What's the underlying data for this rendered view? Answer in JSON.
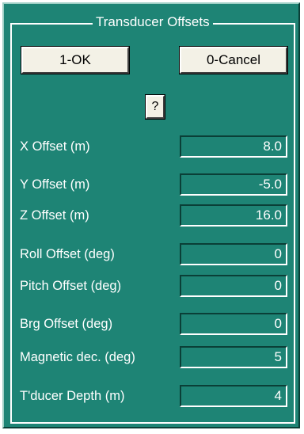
{
  "window": {
    "group_title": "Transducer Offsets"
  },
  "buttons": {
    "ok_label": "1-OK",
    "cancel_label": "0-Cancel",
    "help_label": "?"
  },
  "fields": [
    {
      "label": "X Offset (m)",
      "value": "8.0"
    },
    {
      "label": "Y Offset (m)",
      "value": "-5.0"
    },
    {
      "label": "Z Offset (m)",
      "value": "16.0"
    },
    {
      "label": "Roll Offset (deg)",
      "value": "0"
    },
    {
      "label": "Pitch Offset (deg)",
      "value": "0"
    },
    {
      "label": "Brg Offset (deg)",
      "value": "0"
    },
    {
      "label": "Magnetic dec. (deg)",
      "value": "5"
    },
    {
      "label": "T'ducer Depth (m)",
      "value": "4"
    }
  ],
  "colors": {
    "panel_background": "#1e8475",
    "button_face": "#f3f1e6",
    "text": "#ffffff"
  }
}
